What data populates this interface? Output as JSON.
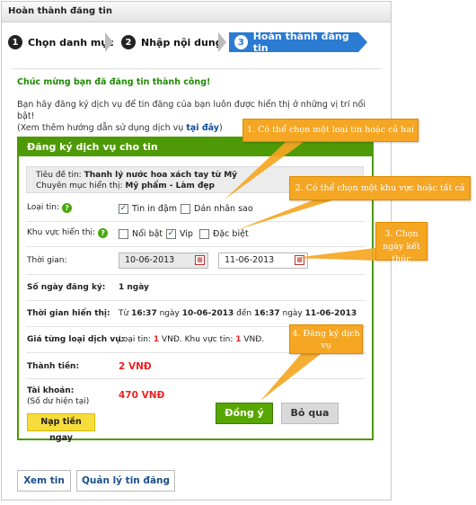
{
  "header": {
    "title": "Hoàn thành đăng tin"
  },
  "steps": [
    {
      "num": "1",
      "label": "Chọn danh mục"
    },
    {
      "num": "2",
      "label": "Nhập nội dung"
    },
    {
      "num": "3",
      "label": "Hoàn thành đăng tin"
    }
  ],
  "success_message": "Chúc mừng bạn đã đăng tin thành công!",
  "intro": {
    "line1": "Bạn hãy  đăng ký dịch vụ để tin đăng của bạn luôn được hiển thị ở những vị trí nổi bật!",
    "line2_prefix": "(Xem thêm hướng dẫn sử dụng dịch vụ ",
    "link": "tại đây",
    "line2_suffix": ")"
  },
  "service_box": {
    "title": "Đăng ký dịch vụ cho tin",
    "post_title_label": "Tiêu đề tin:",
    "post_title": "Thanh lý nước hoa xách tay từ Mỹ",
    "category_label": "Chuyên mục hiển thị:",
    "category": "Mỹ phẩm - Làm đẹp",
    "type_label": "Loại tin:",
    "type_options": [
      {
        "label": "Tin in đậm",
        "checked": true
      },
      {
        "label": "Dán nhãn sao",
        "checked": false
      }
    ],
    "area_label": "Khu vực hiển thị:",
    "area_options": [
      {
        "label": "Nổi bật",
        "checked": false
      },
      {
        "label": "Vip",
        "checked": true
      },
      {
        "label": "Đặc biệt",
        "checked": false
      }
    ],
    "time_label": "Thời gian:",
    "start_date": "10-06-2013",
    "end_date": "11-06-2013",
    "days_label": "Số ngày đăng ký:",
    "days_value": "1 ngày",
    "display_time_label": "Thời gian hiển thị:",
    "display_time": {
      "p1": "Từ ",
      "t1": "16:37",
      "p2": " ngày ",
      "d1": "10-06-2013",
      "p3": " đến ",
      "t2": "16:37",
      "p4": " ngày ",
      "d2": "11-06-2013"
    },
    "price_label": "Giá từng loại dịch vụ:",
    "price": {
      "p1": "Loại tin: ",
      "v1": "1",
      "p2": " VNĐ. Khu vực tin: ",
      "v2": "1",
      "p3": " VNĐ."
    },
    "total_label": "Thành tiền:",
    "total_value": "2 VNĐ",
    "account_label": "Tài khoản:",
    "account_sub": "(Số dư hiện tại)",
    "account_value": "470 VNĐ",
    "topup_button": "Nạp tiền ngay",
    "ok_button": "Đồng ý",
    "skip_button": "Bỏ qua"
  },
  "bottom": {
    "view_button": "Xem tin",
    "manage_button": "Quản lý tin đăng"
  },
  "callouts": [
    "1. Có thể chọn một loại tin hoặc cả hai",
    "2. Có thể chọn một khu vực hoặc tất cả",
    "3. Chọn ngày kết thúc",
    "4. Đăng ký dịch vụ"
  ],
  "colors": {
    "green": "#4e9a06",
    "blue_step": "#2a7bd1",
    "callout": "#f5a623",
    "price_red": "#e22222"
  },
  "icons": {
    "help": "help-icon",
    "calendar": "calendar-icon",
    "check": "checkbox"
  }
}
